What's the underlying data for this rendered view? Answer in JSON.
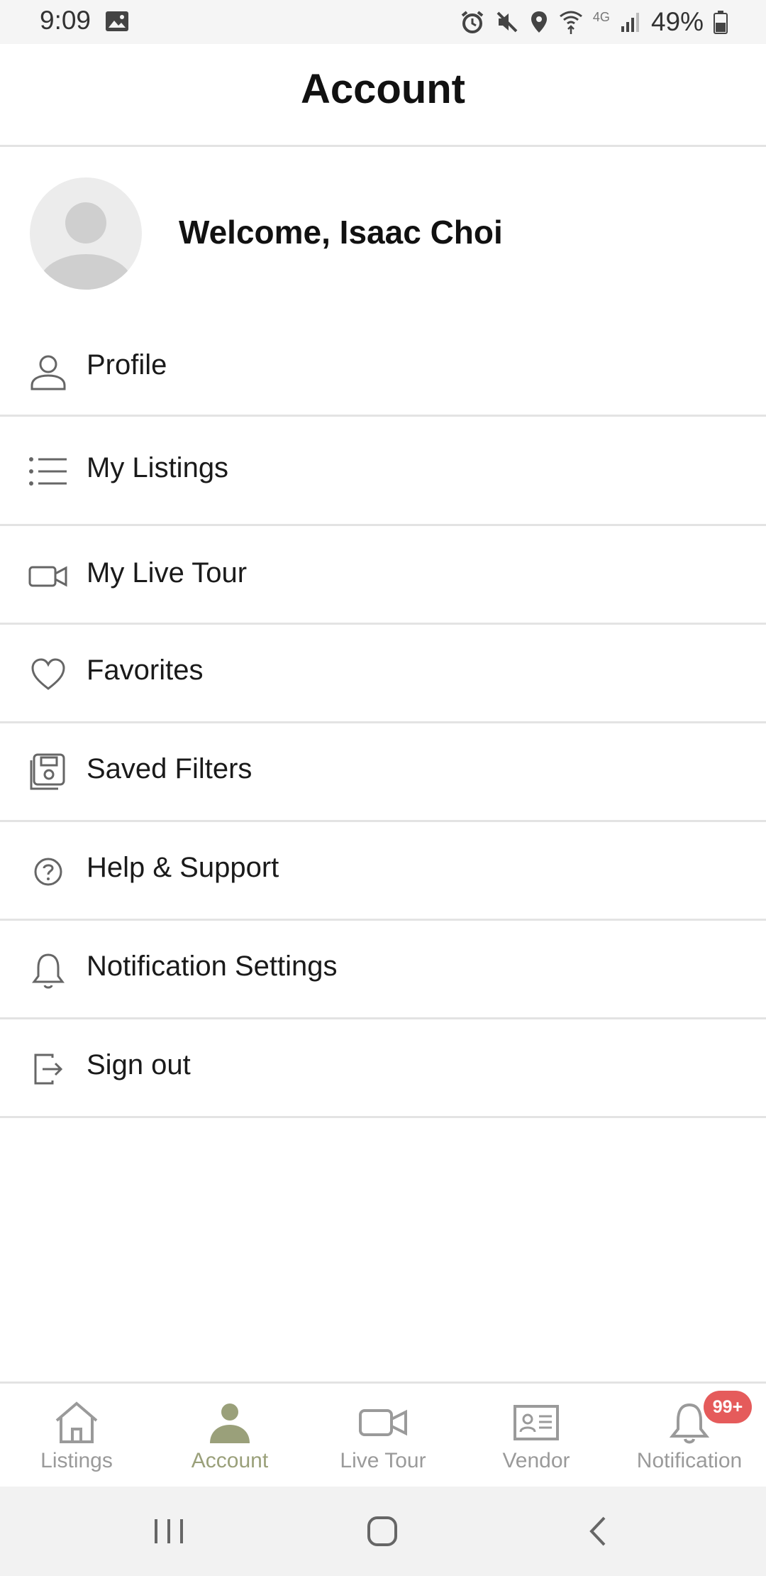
{
  "status_bar": {
    "time": "9:09",
    "network": "4G",
    "battery": "49%"
  },
  "header": {
    "title": "Account"
  },
  "welcome": {
    "text": "Welcome, Isaac Choi"
  },
  "menu": [
    {
      "label": "Profile",
      "icon": "person-icon"
    },
    {
      "label": "My Listings",
      "icon": "list-icon"
    },
    {
      "label": "My Live Tour",
      "icon": "video-camera-icon"
    },
    {
      "label": "Favorites",
      "icon": "heart-icon"
    },
    {
      "label": "Saved Filters",
      "icon": "floppy-disk-icon"
    },
    {
      "label": "Help & Support",
      "icon": "question-circle-icon"
    },
    {
      "label": "Notification Settings",
      "icon": "bell-icon"
    },
    {
      "label": "Sign out",
      "icon": "sign-out-icon"
    }
  ],
  "bottom_nav": {
    "items": [
      {
        "label": "Listings",
        "icon": "home-icon"
      },
      {
        "label": "Account",
        "icon": "account-icon",
        "active": true
      },
      {
        "label": "Live Tour",
        "icon": "video-camera-icon"
      },
      {
        "label": "Vendor",
        "icon": "id-card-icon"
      },
      {
        "label": "Notification",
        "icon": "bell-icon",
        "badge": "99+"
      }
    ]
  },
  "colors": {
    "active_tab": "#9aa07a",
    "inactive_tab": "#9a9a9a",
    "badge": "#e55b5b",
    "divider": "#e3e3e3"
  }
}
